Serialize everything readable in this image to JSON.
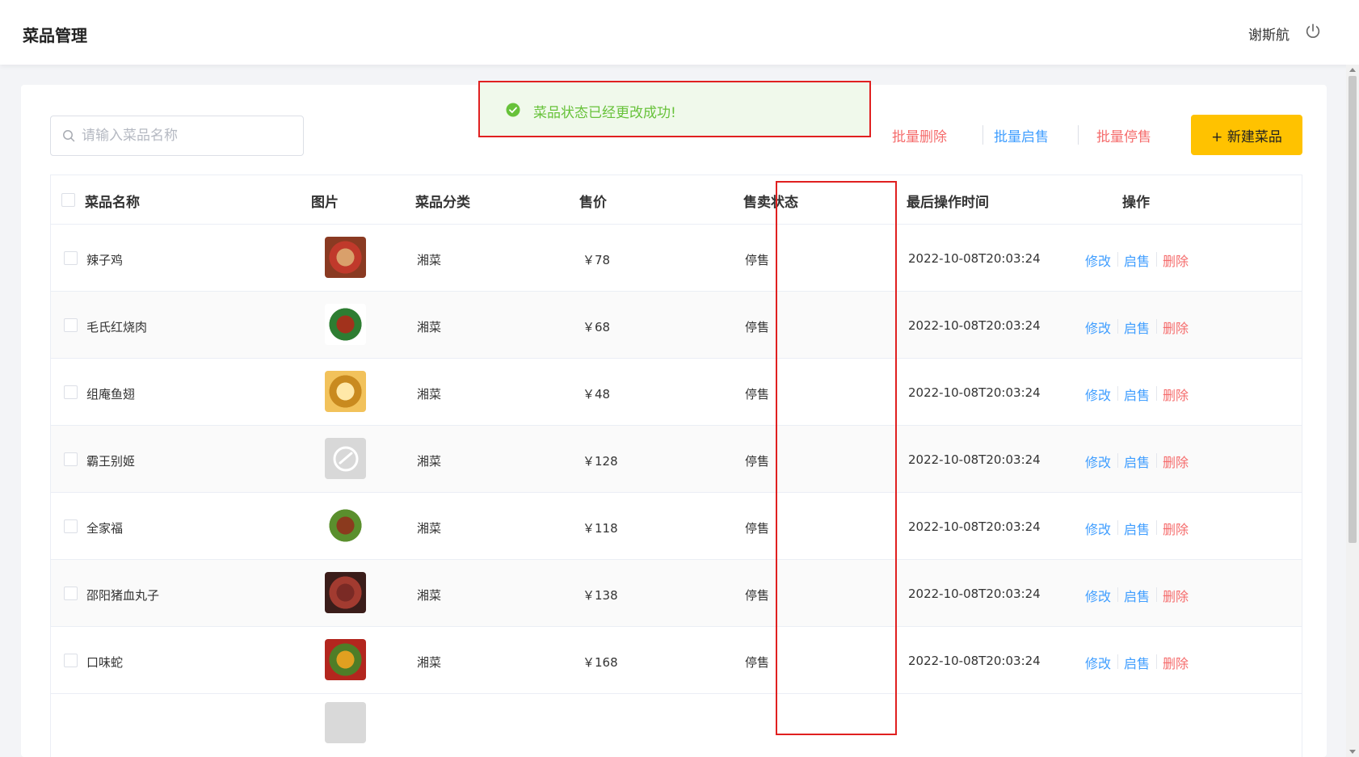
{
  "header": {
    "title": "菜品管理",
    "user_name": "谢斯航"
  },
  "search": {
    "placeholder": "请输入菜品名称",
    "value": ""
  },
  "toast": {
    "message": "菜品状态已经更改成功!"
  },
  "toolbar": {
    "batch_delete": "批量删除",
    "batch_enable": "批量启售",
    "batch_disable": "批量停售",
    "new_dish": "+ 新建菜品"
  },
  "table": {
    "columns": [
      "菜品名称",
      "图片",
      "菜品分类",
      "售价",
      "售卖状态",
      "最后操作时间",
      "操作"
    ],
    "rows": [
      {
        "name": "辣子鸡",
        "image": "dish-photo",
        "category": "湘菜",
        "price": "￥78",
        "status": "停售",
        "updated": "2022-10-08T20:03:24",
        "edit": "修改",
        "toggle": "启售",
        "delete": "删除"
      },
      {
        "name": "毛氏红烧肉",
        "image": "dish-photo",
        "category": "湘菜",
        "price": "￥68",
        "status": "停售",
        "updated": "2022-10-08T20:03:24",
        "edit": "修改",
        "toggle": "启售",
        "delete": "删除"
      },
      {
        "name": "组庵鱼翅",
        "image": "dish-photo",
        "category": "湘菜",
        "price": "￥48",
        "status": "停售",
        "updated": "2022-10-08T20:03:24",
        "edit": "修改",
        "toggle": "启售",
        "delete": "删除"
      },
      {
        "name": "霸王别姬",
        "image": "placeholder-icon",
        "category": "湘菜",
        "price": "￥128",
        "status": "停售",
        "updated": "2022-10-08T20:03:24",
        "edit": "修改",
        "toggle": "启售",
        "delete": "删除"
      },
      {
        "name": "全家福",
        "image": "dish-photo",
        "category": "湘菜",
        "price": "￥118",
        "status": "停售",
        "updated": "2022-10-08T20:03:24",
        "edit": "修改",
        "toggle": "启售",
        "delete": "删除"
      },
      {
        "name": "邵阳猪血丸子",
        "image": "dish-photo",
        "category": "湘菜",
        "price": "￥138",
        "status": "停售",
        "updated": "2022-10-08T20:03:24",
        "edit": "修改",
        "toggle": "启售",
        "delete": "删除"
      },
      {
        "name": "口味蛇",
        "image": "dish-photo",
        "category": "湘菜",
        "price": "￥168",
        "status": "停售",
        "updated": "2022-10-08T20:03:24",
        "edit": "修改",
        "toggle": "启售",
        "delete": "删除"
      }
    ]
  },
  "colors": {
    "accent": "#ffc200",
    "link_blue": "#409eff",
    "danger_red": "#f56c6c",
    "success_green": "#67c23a",
    "highlight_red": "#e02020"
  }
}
